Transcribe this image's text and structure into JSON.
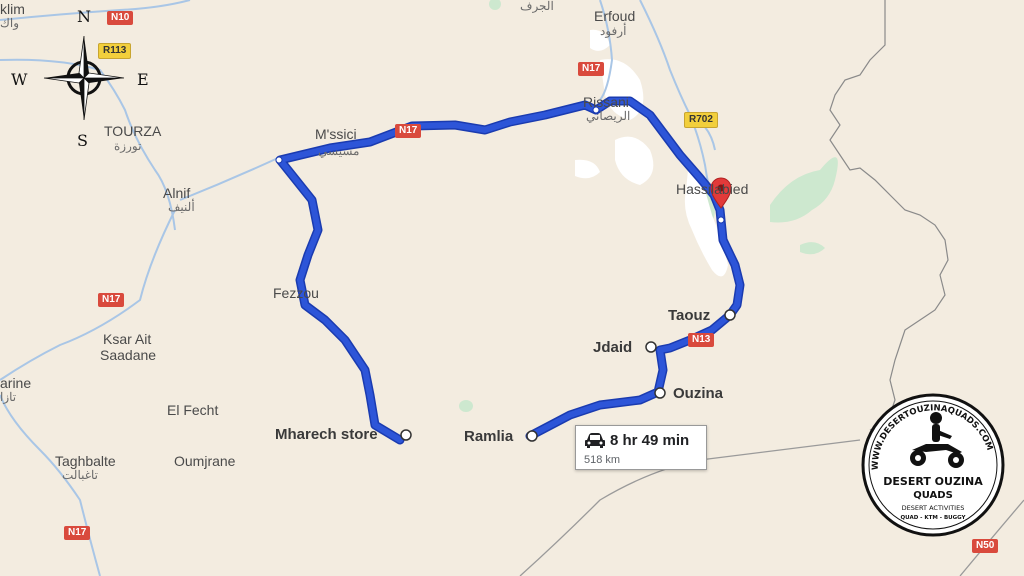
{
  "compass": {
    "north": "N",
    "south": "S",
    "east": "E",
    "west": "W"
  },
  "places": {
    "klim": "klim",
    "klim_ar": "واك",
    "erfoud": "Erfoud",
    "erfoud_ar": "أرفود",
    "jorf_ar": "الجرف",
    "tourza": "TOURZA",
    "tourza_ar": "تورزة",
    "mssici": "M'ssici",
    "mssici_ar": "مسيسي",
    "rissani": "Rissani",
    "rissani_ar": "الريصاني",
    "hassilabied": "Hassilabied",
    "alnif": "Alnif",
    "alnif_ar": "ألنيف",
    "fezzou": "Fezzou",
    "ksar_ait_saadane_1": "Ksar Ait",
    "ksar_ait_saadane_2": "Saadane",
    "el_fecht": "El Fecht",
    "tazarine": "arine",
    "tazarine_ar": "تازا",
    "taghbalte": "Taghbalte",
    "taghbalte_ar": "تاغبالت",
    "oumjrane": "Oumjrane"
  },
  "stops": {
    "taouz": "Taouz",
    "jdaid": "Jdaid",
    "ouzina": "Ouzina",
    "ramlia": "Ramlia",
    "mharech": "Mharech store"
  },
  "roads": {
    "n10": "N10",
    "r113": "R113",
    "n17_top": "N17",
    "n17_route": "N17",
    "n17_left": "N17",
    "n17_bottom": "N17",
    "r702": "R702",
    "n13": "N13",
    "n50": "N50"
  },
  "route_info": {
    "duration": "8 hr 49 min",
    "distance": "518 km",
    "icon": "car-icon"
  },
  "logo": {
    "url_text": "WWW.DESERTOUZINAQUADS.COM",
    "name_line1": "DESERT OUZINA",
    "name_line2": "QUADS",
    "tagline": "DESERT ACTIVITIES",
    "services": "QUAD - KTM - BUGGY"
  },
  "colors": {
    "background": "#f3ece0",
    "route": "#2d55d8",
    "route_outline": "#1a3bb0",
    "road": "#a9c6e6",
    "border": "#777777",
    "green": "#cde8cf",
    "white_area": "#ffffff",
    "pin": "#e23a3a"
  }
}
